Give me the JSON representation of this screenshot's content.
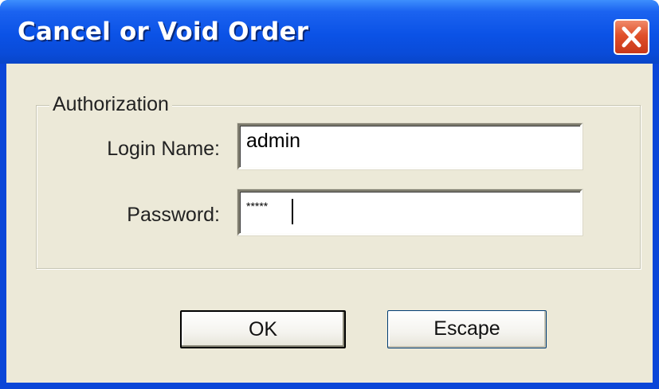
{
  "window": {
    "title": "Cancel or Void Order",
    "close_icon": "close-x-icon"
  },
  "authorization": {
    "legend": "Authorization",
    "login_label": "Login Name:",
    "login_value": "admin",
    "password_label": "Password:",
    "password_value": "*****"
  },
  "buttons": {
    "ok_label": "OK",
    "escape_label": "Escape"
  },
  "colors": {
    "titlebar": "#0b52e6",
    "client_background": "#ece9d8",
    "close_button": "#e0502a"
  }
}
